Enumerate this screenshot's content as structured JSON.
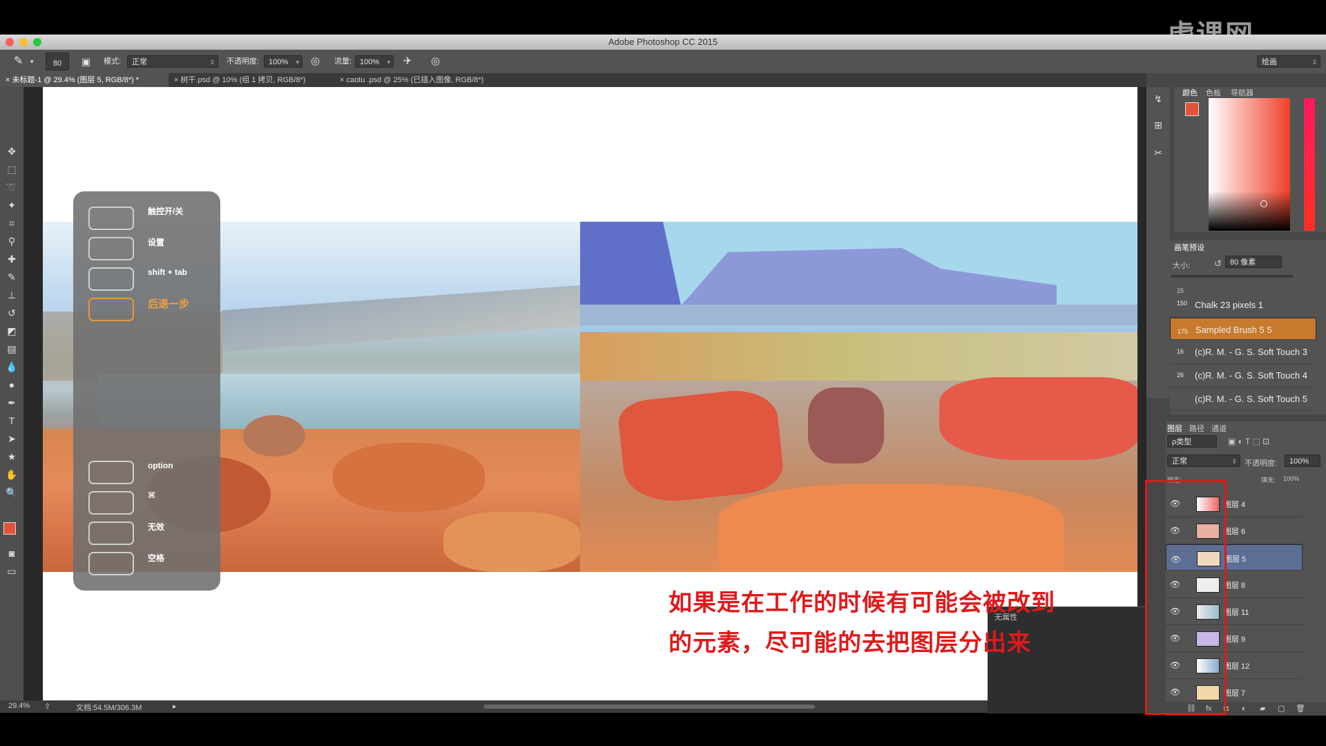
{
  "window": {
    "title": "Adobe Photoshop CC 2015",
    "workspace": "绘画"
  },
  "watermark": "虎课网",
  "options": {
    "brush_size": "80",
    "mode_label": "模式:",
    "mode_value": "正常",
    "opacity_label": "不透明度:",
    "opacity_value": "100%",
    "flow_label": "流量:",
    "flow_value": "100%"
  },
  "tabs": [
    {
      "label": "未标题-1 @ 29.4% (图层 5, RGB/8*) *"
    },
    {
      "label": "树干.psd @ 10% (组 1 拷贝, RGB/8*)"
    },
    {
      "label": "caotu .psd @ 25% (已插入图像, RGB/8*)"
    }
  ],
  "touch_overlay": {
    "items": [
      {
        "label": "触控开/关"
      },
      {
        "label": "设置"
      },
      {
        "label": "shift + tab"
      },
      {
        "label": "后退一步"
      },
      {
        "label": "option"
      },
      {
        "label": "⌘"
      },
      {
        "label": "无效"
      },
      {
        "label": "空格"
      }
    ]
  },
  "caption": {
    "line1": "如果是在工作的时候有可能会被改到",
    "line2": "的元素，尽可能的去把图层分出来"
  },
  "status": {
    "zoom": "29.4%",
    "doc": "文档:54.5M/306.3M"
  },
  "color_panel": {
    "tabs": [
      "颜色",
      "色板",
      "导航器"
    ],
    "fg": "#e0553a",
    "bg": "#f3b08e"
  },
  "brush_panel": {
    "title": "画笔预设",
    "size_label": "大小:",
    "size_value": "80 像素",
    "brushes": [
      {
        "size": "25",
        "name": ""
      },
      {
        "size": "150",
        "name": "Chalk 23 pixels 1"
      },
      {
        "size": "175",
        "name": "Sampled Brush 5 5"
      },
      {
        "size": "16",
        "name": "(c)R. M. - G. S. Soft Touch 3"
      },
      {
        "size": "26",
        "name": "(c)R. M. - G. S. Soft Touch 4"
      },
      {
        "size": "",
        "name": "(c)R. M. - G. S. Soft Touch 5"
      }
    ]
  },
  "layers_panel": {
    "tabs": [
      "图层",
      "路径",
      "通道"
    ],
    "filter": "ρ类型",
    "blend": "正常",
    "opacity_label": "不透明度:",
    "opacity_value": "100%",
    "fill_label": "填充:",
    "fill_value": "100%",
    "lock_label": "锁定:",
    "layers": [
      {
        "name": "图层 4"
      },
      {
        "name": "图层 6"
      },
      {
        "name": "图层 5"
      },
      {
        "name": "图层 8"
      },
      {
        "name": "图层 11"
      },
      {
        "name": "图层 9"
      },
      {
        "name": "图层 12"
      },
      {
        "name": "图层 7"
      }
    ]
  },
  "properties_panel": {
    "text": "无属性"
  }
}
